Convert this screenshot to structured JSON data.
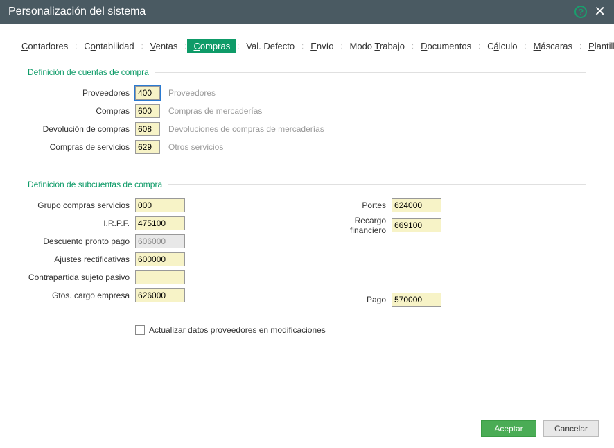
{
  "title": "Personalización del sistema",
  "tabs": [
    "Contadores",
    "Contabilidad",
    "Ventas",
    "Compras",
    "Val. Defecto",
    "Envío",
    "Modo Trabajo",
    "Documentos",
    "Cálculo",
    "Máscaras",
    "Plantillas"
  ],
  "activeTab": 3,
  "group1": {
    "title": "Definición de cuentas de compra",
    "rows": [
      {
        "label": "Proveedores",
        "value": "400",
        "desc": "Proveedores"
      },
      {
        "label": "Compras",
        "value": "600",
        "desc": "Compras de mercaderías"
      },
      {
        "label": "Devolución de compras",
        "value": "608",
        "desc": "Devoluciones de compras de mercaderías"
      },
      {
        "label": "Compras de servicios",
        "value": "629",
        "desc": "Otros servicios"
      }
    ]
  },
  "group2": {
    "title": "Definición de subcuentas de compra",
    "left": [
      {
        "label": "Grupo compras servicios",
        "value": "000",
        "disabled": false
      },
      {
        "label": "I.R.P.F.",
        "value": "475100",
        "disabled": false
      },
      {
        "label": "Descuento pronto pago",
        "value": "606000",
        "disabled": true
      },
      {
        "label": "Ajustes rectificativas",
        "value": "600000",
        "disabled": false
      },
      {
        "label": "Contrapartida sujeto pasivo",
        "value": "",
        "disabled": false
      },
      {
        "label": "Gtos. cargo empresa",
        "value": "626000",
        "disabled": false
      }
    ],
    "right": [
      {
        "label": "Portes",
        "value": "624000"
      },
      {
        "label": "Recargo financiero",
        "value": "669100"
      }
    ],
    "pago": {
      "label": "Pago",
      "value": "570000"
    }
  },
  "checkbox": {
    "label": "Actualizar datos proveedores en modificaciones"
  },
  "buttons": {
    "accept": "Aceptar",
    "cancel": "Cancelar"
  }
}
